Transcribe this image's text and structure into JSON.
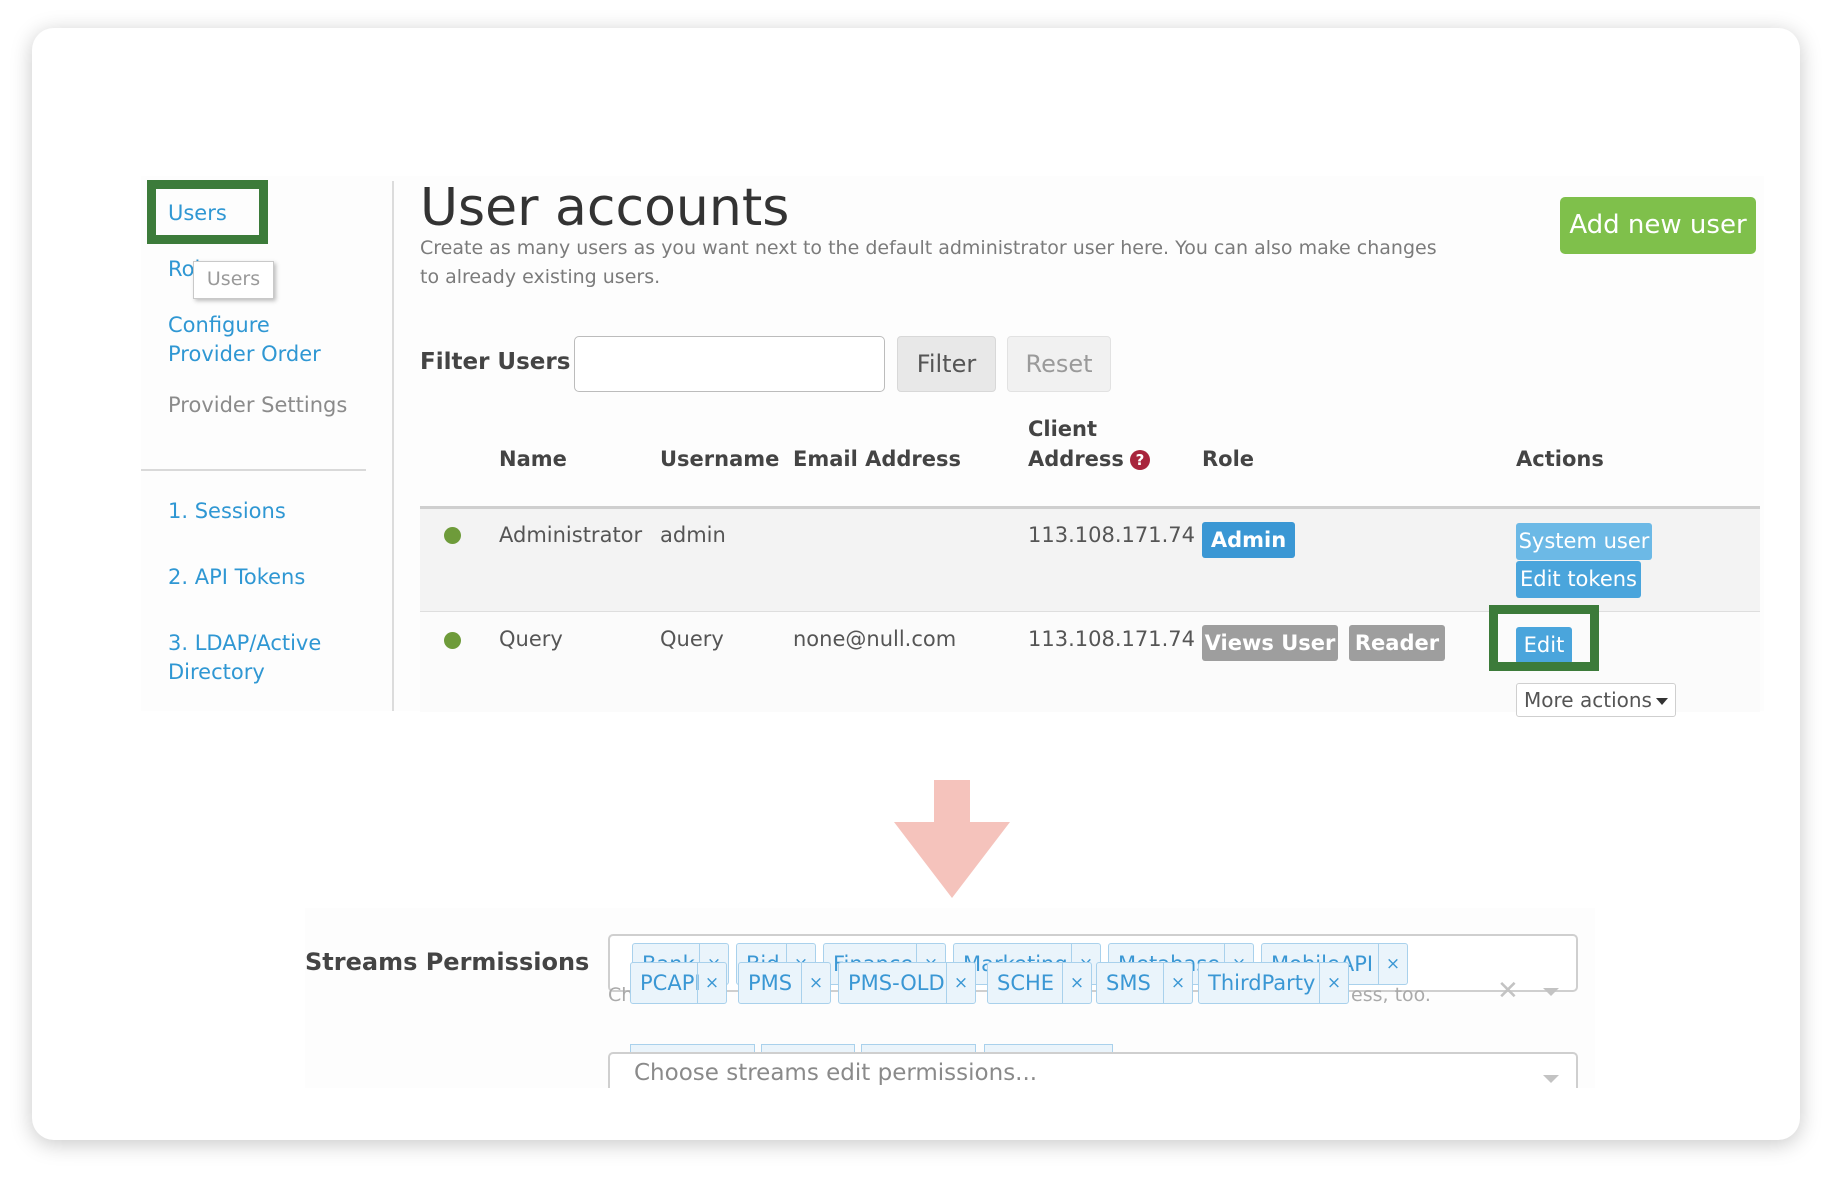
{
  "sidebar": {
    "items": [
      {
        "label": "Users"
      },
      {
        "label": "Roles"
      },
      {
        "label": "Configure Provider Order"
      },
      {
        "label": "Provider Settings"
      },
      {
        "label": "1. Sessions"
      },
      {
        "label": "2. API Tokens"
      },
      {
        "label": "3. LDAP/Active Directory"
      }
    ],
    "tooltip": "Users"
  },
  "header": {
    "title": "User accounts",
    "subtitle": "Create as many users as you want next to the default administrator user here. You can also make changes to already existing users.",
    "add_button": "Add new user"
  },
  "filter": {
    "label": "Filter Users",
    "input_value": "",
    "filter_button": "Filter",
    "reset_button": "Reset"
  },
  "table": {
    "columns": [
      "Name",
      "Username",
      "Email Address",
      "Client Address",
      "Role",
      "Actions"
    ],
    "rows": [
      {
        "name": "Administrator",
        "username": "admin",
        "email": "",
        "client_address": "113.108.171.74",
        "roles": [
          "Admin"
        ],
        "actions": [
          "System user",
          "Edit tokens"
        ]
      },
      {
        "name": "Query",
        "username": "Query",
        "email": "none@null.com",
        "client_address": "113.108.171.74",
        "roles": [
          "Views User",
          "Reader"
        ],
        "actions": [
          "Edit",
          "More actions"
        ]
      }
    ]
  },
  "permissions": {
    "label": "Streams Permissions",
    "tags_row1": [
      "Bank",
      "Bid",
      "Finance",
      "Marketing",
      "Metabase",
      "MobileAPI"
    ],
    "tags_row2": [
      "PCAPI",
      "PMS",
      "PMS-OLD",
      "SCHE",
      "SMS",
      "ThirdParty"
    ],
    "hint_start": "Ch",
    "hint_end": "ess, too.",
    "edit_placeholder": "Choose streams edit permissions..."
  },
  "colors": {
    "accent": "#2f97d3",
    "add_button": "#7fc04b",
    "highlight_box": "#3c7b3a",
    "arrow": "#f5c3bc",
    "role_admin": "#3a97d4",
    "role_grey": "#9e9e9e",
    "status_active": "#6e9b3a"
  },
  "icons": [
    "help-icon",
    "clear-icon",
    "chevron-down-icon",
    "down-arrow-icon",
    "close-icon"
  ]
}
